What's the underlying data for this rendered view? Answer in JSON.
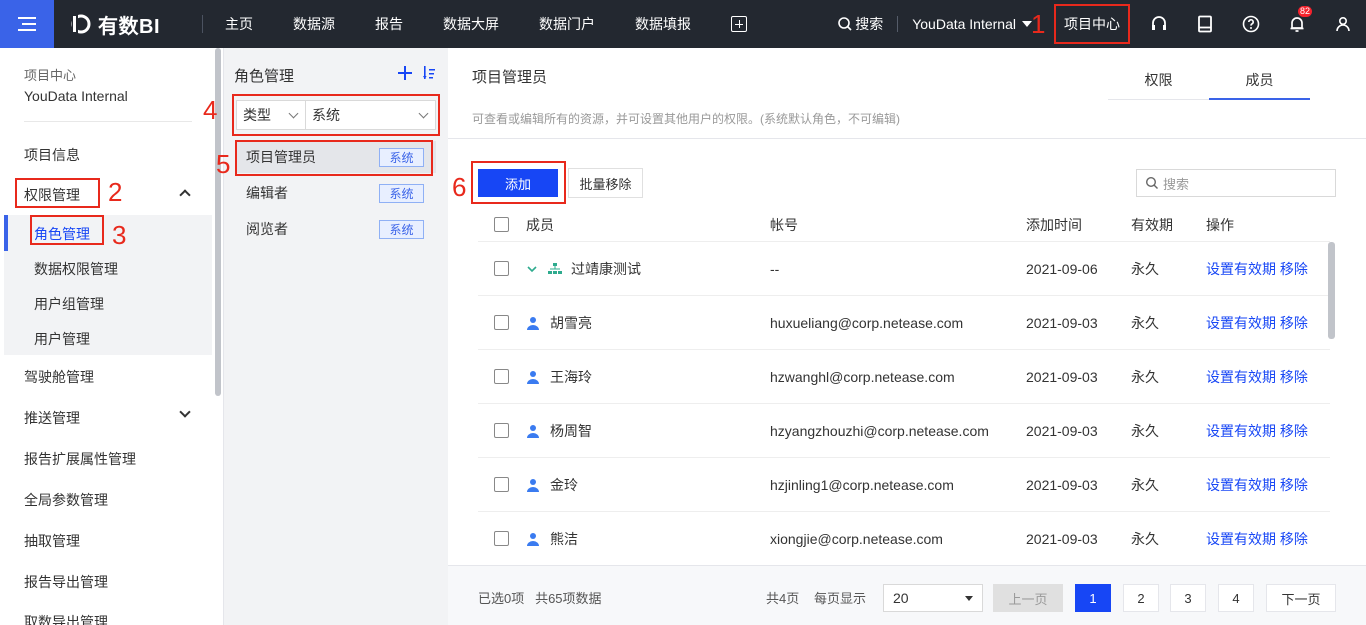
{
  "topbar": {
    "logo": "有数BI",
    "nav": [
      "主页",
      "数据源",
      "报告",
      "数据大屏",
      "数据门户",
      "数据填报"
    ],
    "search": "搜索",
    "project": "YouData Internal",
    "project_center": "项目中心",
    "notif_count": "82",
    "accent": "#3a63e8"
  },
  "markers": [
    "1",
    "2",
    "3",
    "4",
    "5",
    "6"
  ],
  "sidebar": {
    "head_label": "项目中心",
    "head_project": "YouData Internal",
    "items": {
      "info": "项目信息",
      "perm": "权限管理",
      "cockpit": "驾驶舱管理",
      "push": "推送管理",
      "ext": "报告扩展属性管理",
      "params": "全局参数管理",
      "extract": "抽取管理",
      "export": "报告导出管理",
      "fetch": "取数导出管理"
    },
    "sub": {
      "role": "角色管理",
      "data_perm": "数据权限管理",
      "group": "用户组管理",
      "user": "用户管理"
    }
  },
  "role_panel": {
    "title": "角色管理",
    "filter_type": "类型",
    "filter_value": "系统",
    "roles": [
      {
        "name": "项目管理员",
        "tag": "系统"
      },
      {
        "name": "编辑者",
        "tag": "系统"
      },
      {
        "name": "阅览者",
        "tag": "系统"
      }
    ]
  },
  "main": {
    "title": "项目管理员",
    "desc": "可查看或编辑所有的资源，并可设置其他用户的权限。(系统默认角色，不可编辑)",
    "tabs": [
      "权限",
      "成员"
    ],
    "add": "添加",
    "batch_remove": "批量移除",
    "search_placeholder": "搜索",
    "columns": [
      "成员",
      "帐号",
      "添加时间",
      "有效期",
      "操作"
    ],
    "rows": [
      {
        "name": "过靖康测试",
        "account": "--",
        "time": "2021-09-06",
        "valid": "永久",
        "set": "设置有效期",
        "remove": "移除"
      },
      {
        "name": "胡雪亮",
        "account": "huxueliang@corp.netease.com",
        "time": "2021-09-03",
        "valid": "永久",
        "set": "设置有效期",
        "remove": "移除"
      },
      {
        "name": "王海玲",
        "account": "hzwanghl@corp.netease.com",
        "time": "2021-09-03",
        "valid": "永久",
        "set": "设置有效期",
        "remove": "移除"
      },
      {
        "name": "杨周智",
        "account": "hzyangzhouzhi@corp.netease.com",
        "time": "2021-09-03",
        "valid": "永久",
        "set": "设置有效期",
        "remove": "移除"
      },
      {
        "name": "金玲",
        "account": "hzjinling1@corp.netease.com",
        "time": "2021-09-03",
        "valid": "永久",
        "set": "设置有效期",
        "remove": "移除"
      },
      {
        "name": "熊洁",
        "account": "xiongjie@corp.netease.com",
        "time": "2021-09-03",
        "valid": "永久",
        "set": "设置有效期",
        "remove": "移除"
      }
    ],
    "footer": {
      "selected": "已选0项",
      "total": "共65项数据",
      "pages": "共4页",
      "per_page_label": "每页显示",
      "per_page": "20",
      "prev": "上一页",
      "page_nums": [
        "1",
        "2",
        "3",
        "4"
      ],
      "next": "下一页"
    }
  }
}
